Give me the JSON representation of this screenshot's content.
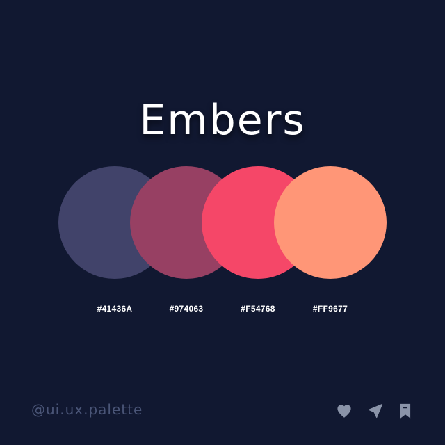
{
  "palette": {
    "title": "Embers",
    "colors": [
      {
        "hex": "#41436A",
        "label": "#41436A"
      },
      {
        "hex": "#974063",
        "label": "#974063"
      },
      {
        "hex": "#F54768",
        "label": "#F54768"
      },
      {
        "hex": "#FF9677",
        "label": "#FF9677"
      }
    ]
  },
  "footer": {
    "handle": "@ui.ux.palette",
    "icons": [
      "heart-icon",
      "send-icon",
      "bookmark-icon"
    ]
  },
  "theme": {
    "background": "#111831",
    "text": "#FFFFFF",
    "muted": "#4A5577",
    "icon": "#8A93A8"
  }
}
